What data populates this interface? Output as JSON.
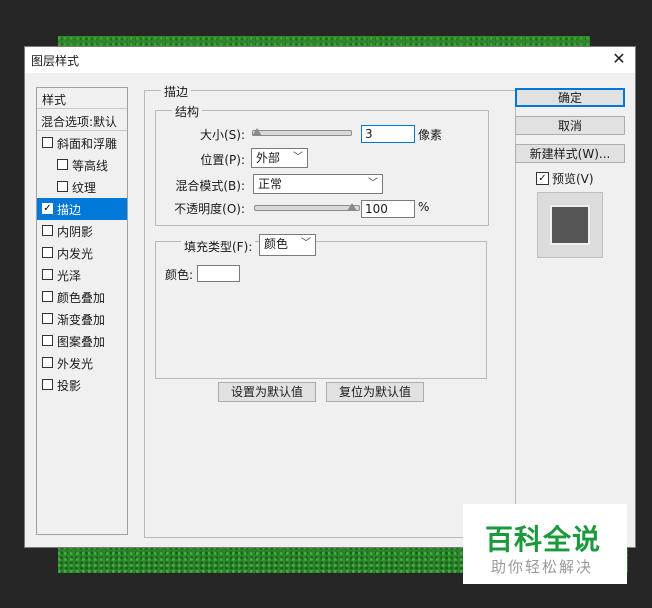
{
  "window": {
    "title": "图层样式",
    "close_glyph": "✕"
  },
  "styles_panel": {
    "header": "样式",
    "blend_options": "混合选项:默认",
    "items": [
      {
        "label": "斜面和浮雕",
        "checked": false,
        "indent": false
      },
      {
        "label": "等高线",
        "checked": false,
        "indent": true
      },
      {
        "label": "纹理",
        "checked": false,
        "indent": true
      },
      {
        "label": "描边",
        "checked": true,
        "indent": false,
        "selected": true
      },
      {
        "label": "内阴影",
        "checked": false,
        "indent": false
      },
      {
        "label": "内发光",
        "checked": false,
        "indent": false
      },
      {
        "label": "光泽",
        "checked": false,
        "indent": false
      },
      {
        "label": "颜色叠加",
        "checked": false,
        "indent": false
      },
      {
        "label": "渐变叠加",
        "checked": false,
        "indent": false
      },
      {
        "label": "图案叠加",
        "checked": false,
        "indent": false
      },
      {
        "label": "外发光",
        "checked": false,
        "indent": false
      },
      {
        "label": "投影",
        "checked": false,
        "indent": false
      }
    ]
  },
  "stroke": {
    "section_title": "描边",
    "structure_title": "结构",
    "size_label": "大小(S):",
    "size_value": "3",
    "size_unit": "像素",
    "position_label": "位置(P):",
    "position_value": "外部",
    "blend_mode_label": "混合模式(B):",
    "blend_mode_value": "正常",
    "opacity_label": "不透明度(O):",
    "opacity_value": "100",
    "opacity_unit": "%",
    "fill_type_label": "填充类型(F):",
    "fill_type_value": "颜色",
    "color_label": "颜色:",
    "color_value": "#ffffff",
    "set_default_button": "设置为默认值",
    "reset_default_button": "复位为默认值"
  },
  "actions": {
    "ok_button": "确定",
    "cancel_button": "取消",
    "new_style_button": "新建样式(W)...",
    "preview_label": "预览(V)",
    "preview_checked": true
  },
  "watermark": {
    "main": "百科全说",
    "sub": "助你轻松解决"
  },
  "colors": {
    "accent": "#0078d7",
    "watermark_green": "#1a9a3c"
  },
  "icons": {
    "checkbox_mark": "✓",
    "dropdown": "﹀"
  }
}
